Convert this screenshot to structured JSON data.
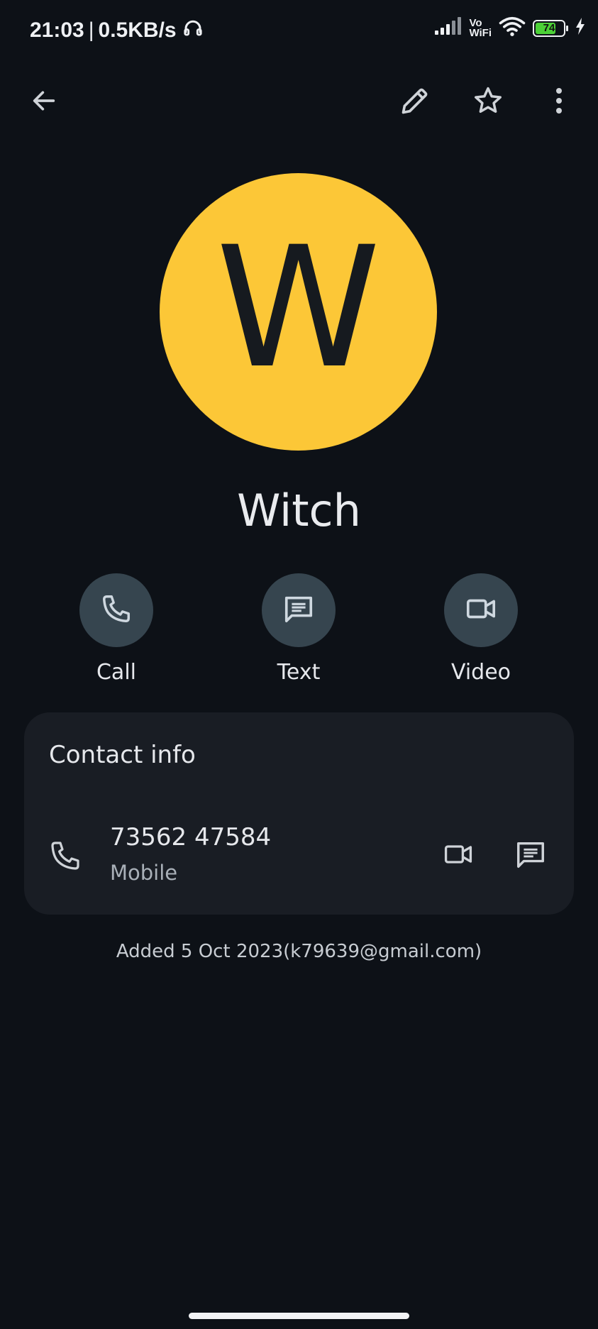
{
  "status_bar": {
    "time": "21:03",
    "separator": "|",
    "speed": "0.5KB/s",
    "vowifi_top": "Vo",
    "vowifi_bottom": "WiFi",
    "battery": "74",
    "icons": [
      "headphones-icon",
      "signal-icon",
      "wifi-icon",
      "battery-icon",
      "charging-icon"
    ]
  },
  "toolbar": {
    "icons": [
      "back-arrow-icon",
      "edit-pencil-icon",
      "star-icon",
      "more-vert-icon"
    ]
  },
  "contact": {
    "initial": "W",
    "name": "Witch",
    "avatar_color": "#fcc737"
  },
  "actions": [
    {
      "label": "Call",
      "icon": "phone-icon"
    },
    {
      "label": "Text",
      "icon": "message-icon"
    },
    {
      "label": "Video",
      "icon": "videocam-icon"
    }
  ],
  "contact_info": {
    "title": "Contact info",
    "phone_number": "73562 47584",
    "phone_type": "Mobile"
  },
  "footer": {
    "added_text": "Added 5 Oct 2023(k79639@gmail.com)"
  },
  "colors": {
    "background": "#0d1117",
    "card": "#191d24",
    "action_circle": "#36454f",
    "accent_yellow": "#fcc737"
  }
}
